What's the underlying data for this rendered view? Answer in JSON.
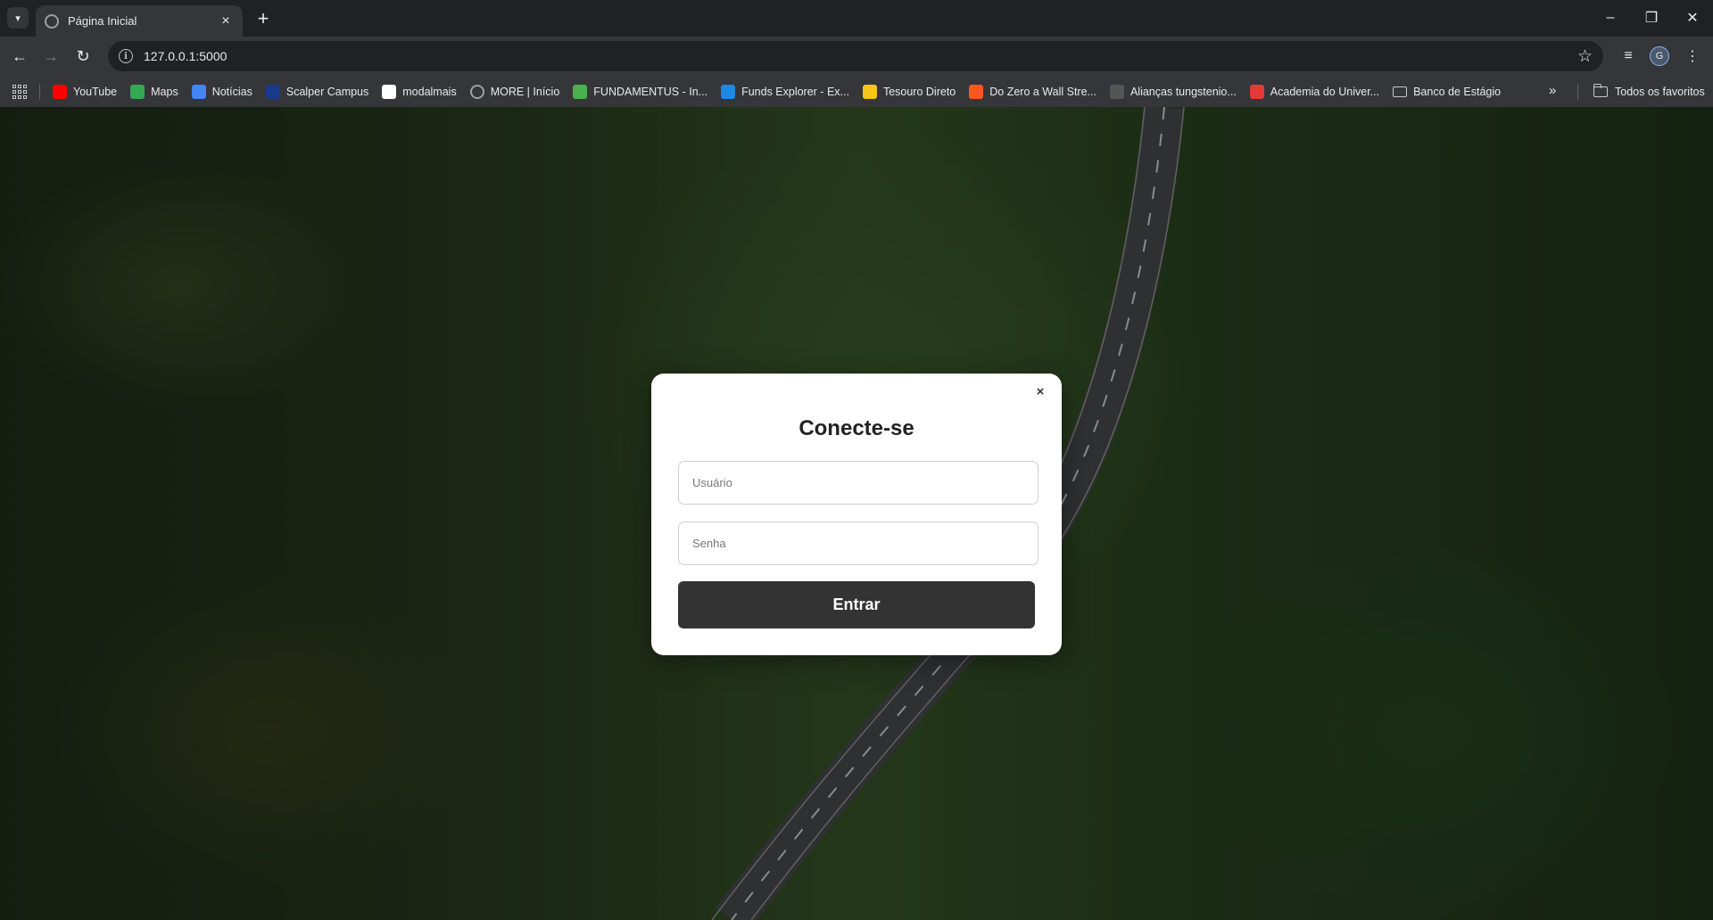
{
  "browser": {
    "tab_title": "Página Inicial",
    "url": "127.0.0.1:5000",
    "profile_initial": "G",
    "bookmarks": [
      {
        "label": "YouTube",
        "icon": "youtube-icon",
        "color": "#ff0000"
      },
      {
        "label": "Maps",
        "icon": "maps-icon",
        "color": "#34a853"
      },
      {
        "label": "Notícias",
        "icon": "news-icon",
        "color": "#4285f4"
      },
      {
        "label": "Scalper Campus",
        "icon": "scalper-icon",
        "color": "#1a3a8a"
      },
      {
        "label": "modalmais",
        "icon": "modalmais-icon",
        "color": "#ffffff"
      },
      {
        "label": "MORE | Início",
        "icon": "globe-icon",
        "color": "#9aa0a6"
      },
      {
        "label": "FUNDAMENTUS - In...",
        "icon": "fundamentus-icon",
        "color": "#4caf50"
      },
      {
        "label": "Funds Explorer - Ex...",
        "icon": "funds-explorer-icon",
        "color": "#1e88e5"
      },
      {
        "label": "Tesouro Direto",
        "icon": "tesouro-icon",
        "color": "#f5c518"
      },
      {
        "label": "Do Zero a Wall Stre...",
        "icon": "fire-icon",
        "color": "#ff5722"
      },
      {
        "label": "Alianças tungstenio...",
        "icon": "ring-icon",
        "color": "#555555"
      },
      {
        "label": "Academia do Univer...",
        "icon": "academia-icon",
        "color": "#e53935"
      },
      {
        "label": "Banco de Estágio",
        "icon": "folder-icon",
        "color": "#c4c7c5"
      }
    ],
    "all_bookmarks_label": "Todos os favoritos"
  },
  "modal": {
    "title": "Conecte-se",
    "close_label": "×",
    "username_placeholder": "Usuário",
    "password_placeholder": "Senha",
    "submit_label": "Entrar"
  }
}
